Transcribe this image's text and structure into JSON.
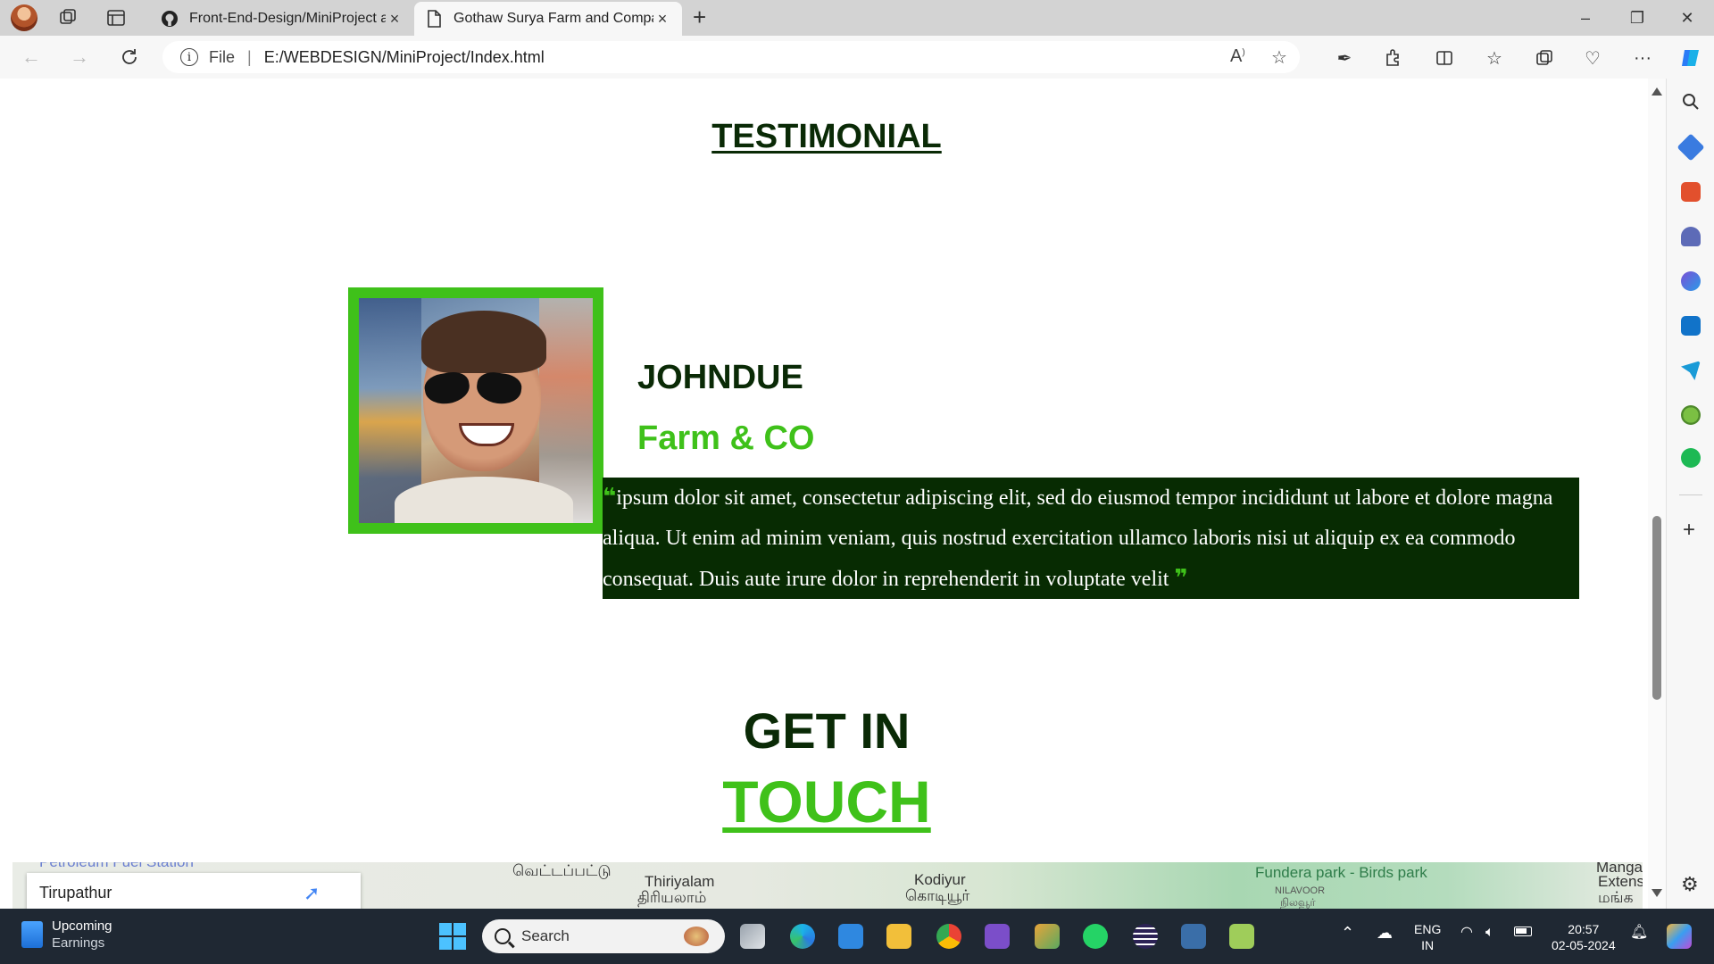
{
  "browser": {
    "tabs": [
      {
        "title": "Front-End-Design/MiniProject at",
        "icon": "github-icon",
        "close": "×"
      },
      {
        "title": "Gothaw Surya Farm and Compan",
        "icon": "document-icon",
        "close": "×"
      }
    ],
    "new_tab": "+",
    "address": {
      "scheme_label": "File",
      "url": "E:/WEBDESIGN/MiniProject/Index.html"
    },
    "window_controls": {
      "minimize": "–",
      "restore": "❐",
      "close": "✕"
    }
  },
  "page": {
    "testimonial_heading": "TESTIMONIAL",
    "testimonial": {
      "name": "JOHNDUE",
      "company": "Farm & CO",
      "open_quote": "❝",
      "quote": "ipsum dolor sit amet, consectetur adipiscing elit, sed do eiusmod tempor incididunt ut labore et dolore magna aliqua. Ut enim ad minim veniam, quis nostrud exercitation ullamco laboris nisi ut aliquip ex ea commodo consequat. Duis aute irure dolor in reprehenderit in voluptate velit",
      "close_quote": "❞"
    },
    "contact_heading_line1": "GET IN",
    "contact_heading_line2": "TOUCH",
    "map": {
      "labels": [
        "Petroleum Fuel Station",
        "வெட்டப்பட்டு",
        "Thiriyalam",
        "திரியலாம்",
        "Kodiyur",
        "கொடியூர்",
        "Fundera park - Birds park",
        "NILAVOOR",
        "நிலவூர்",
        "Manga",
        "Extens",
        "மங்க"
      ],
      "place_card": "Tirupathur"
    }
  },
  "taskbar": {
    "weather_title": "Upcoming",
    "weather_subtitle": "Earnings",
    "search_placeholder": "Search",
    "language_line1": "ENG",
    "language_line2": "IN",
    "time": "20:57",
    "date": "02-05-2024"
  },
  "colors": {
    "dark_green": "#0a2a06",
    "accent_green": "#3fc11a",
    "quote_bg": "#072b02"
  }
}
